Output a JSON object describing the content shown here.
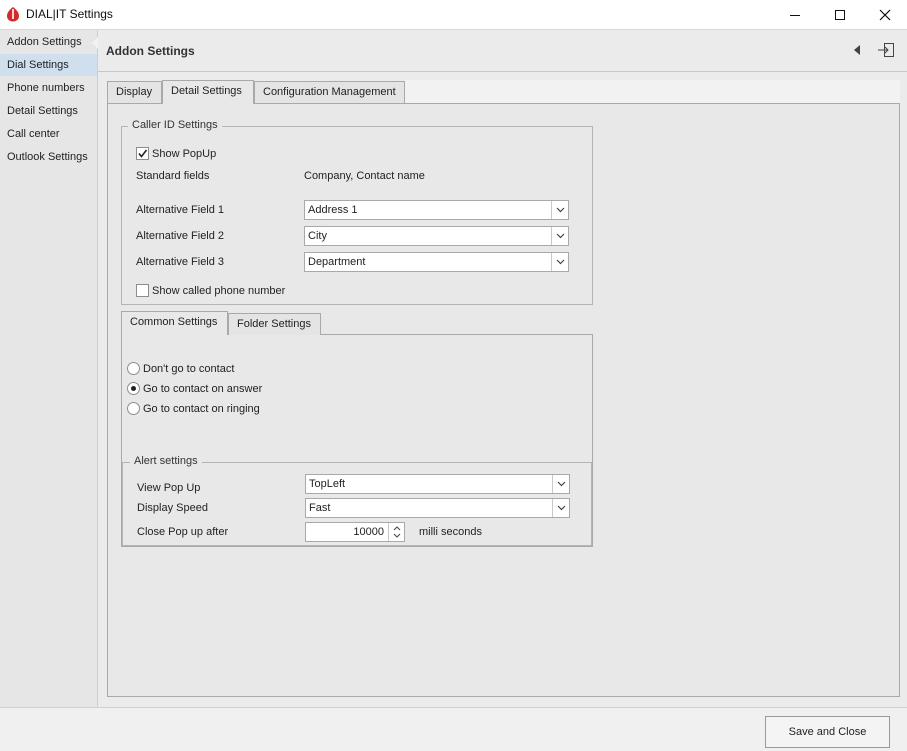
{
  "window": {
    "title": "DIAL|IT Settings"
  },
  "sidebar": {
    "items": [
      {
        "label": "Addon Settings"
      },
      {
        "label": "Dial Settings",
        "active": true
      },
      {
        "label": "Phone numbers"
      },
      {
        "label": "Detail Settings"
      },
      {
        "label": "Call center"
      },
      {
        "label": "Outlook Settings"
      }
    ]
  },
  "header": {
    "title": "Addon Settings"
  },
  "tabs": [
    {
      "label": "Display"
    },
    {
      "label": "Detail Settings",
      "active": true
    },
    {
      "label": "Configuration Management"
    }
  ],
  "caller_id": {
    "group_label": "Caller ID Settings",
    "show_popup": {
      "label": "Show PopUp",
      "checked": true
    },
    "standard_fields": {
      "label": "Standard fields",
      "value": "Company, Contact name"
    },
    "alt_fields": [
      {
        "label": "Alternative Field 1",
        "value": "Address 1"
      },
      {
        "label": "Alternative Field 2",
        "value": "City"
      },
      {
        "label": "Alternative Field 3",
        "value": "Department"
      }
    ],
    "show_called_number": {
      "label": "Show called phone number",
      "checked": false
    }
  },
  "inner_tabs": [
    {
      "label": "Common Settings",
      "active": true
    },
    {
      "label": "Folder Settings"
    }
  ],
  "contact_options": [
    {
      "label": "Don't go to contact",
      "selected": false
    },
    {
      "label": "Go to contact on answer",
      "selected": true
    },
    {
      "label": "Go to contact on ringing",
      "selected": false
    }
  ],
  "alert": {
    "group_label": "Alert settings",
    "view_popup": {
      "label": "View Pop Up",
      "value": "TopLeft"
    },
    "display_speed": {
      "label": "Display Speed",
      "value": "Fast"
    },
    "close_after": {
      "label": "Close Pop up after",
      "value": "10000",
      "unit": "milli seconds"
    }
  },
  "footer": {
    "save_close_label": "Save and Close"
  },
  "colors": {
    "logo_red": "#d22b2b",
    "sidebar_active": "#cfdfee"
  }
}
